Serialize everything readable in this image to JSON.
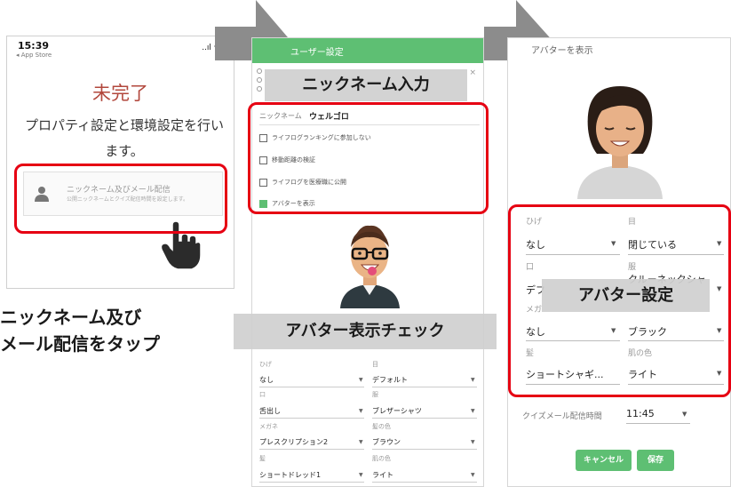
{
  "phone": {
    "time": "15:39",
    "back": "◂ App Store",
    "signal": "..ıl ᯤ",
    "title": "未完了",
    "description": "プロパティ設定と環境設定を行います。",
    "menu_title": "ニックネーム及びメール配信",
    "menu_subtitle": "公開ニックネームとクイズ配信時間を設定します。"
  },
  "caption_tap": [
    "ニックネーム及び",
    "メール配信をタップ"
  ],
  "panel2": {
    "header_title": "ユーザー設定",
    "close_glyph": "×",
    "nickname_label": "ニックネーム",
    "nickname_value": "ウェルゴロ",
    "checkboxes": [
      {
        "label": "ライフログランキングに参加しない",
        "checked": false
      },
      {
        "label": "移動距離の検証",
        "checked": false
      },
      {
        "label": "ライフログを医療職に公開",
        "checked": false
      },
      {
        "label": "アバターを表示",
        "checked": true
      }
    ],
    "fields": [
      {
        "label": "ひげ",
        "value": "なし"
      },
      {
        "label": "目",
        "value": "デフォルト"
      },
      {
        "label": "口",
        "value": "舌出し"
      },
      {
        "label": "服",
        "value": "ブレザーシャツ"
      },
      {
        "label": "メガネ",
        "value": "プレスクリプション2"
      },
      {
        "label": "髪の色",
        "value": "ブラウン"
      },
      {
        "label": "髪",
        "value": "ショートドレッド1"
      },
      {
        "label": "肌の色",
        "value": "ライト"
      }
    ]
  },
  "panel3": {
    "title": "アバターを表示",
    "fields": [
      {
        "label": "ひげ",
        "value": "なし"
      },
      {
        "label": "目",
        "value": "閉じている"
      },
      {
        "label": "口",
        "value": "デフ"
      },
      {
        "label": "服",
        "value": "クルーネックシャ"
      },
      {
        "label": "メガ",
        "value": "なし"
      },
      {
        "label": "",
        "value": "ブラック"
      },
      {
        "label": "髪",
        "value": "ショートシャギ..."
      },
      {
        "label": "肌の色",
        "value": "ライト"
      }
    ],
    "quiz_label": "クイズメール配信時間",
    "quiz_value": "11:45",
    "cancel_label": "キャンセル",
    "save_label": "保存"
  },
  "banners": {
    "nickname": "ニックネーム入力",
    "avatar_check": "アバター表示チェック",
    "avatar_settings": "アバター設定"
  },
  "colors": {
    "accent_green": "#5ebf73",
    "highlight_red": "#e60012",
    "title_red": "#b2473c",
    "arrow_gray": "#8c8c8c"
  }
}
